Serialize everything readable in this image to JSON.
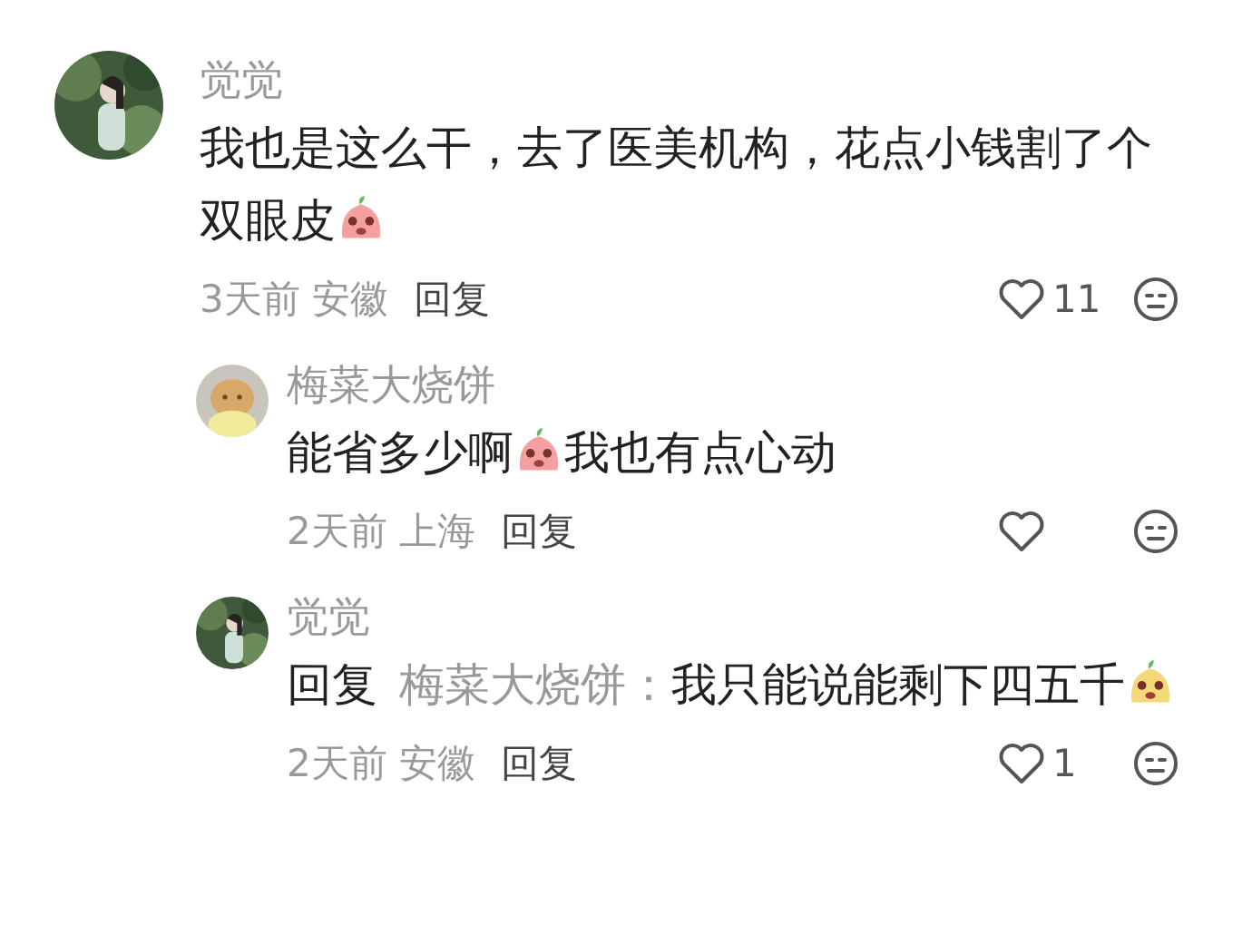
{
  "comments": [
    {
      "author": "觉觉",
      "reply": false,
      "body": [
        {
          "kind": "text",
          "text": "我也是这么干，去了医美机构，花点小钱割了个双眼皮"
        },
        {
          "kind": "emoji",
          "color": "#f4a0a0"
        }
      ],
      "time": "3天前",
      "location": "安徽",
      "reply_label": "回复",
      "likes": "11"
    },
    {
      "author": "梅菜大烧饼",
      "reply": true,
      "body": [
        {
          "kind": "text",
          "text": "能省多少啊"
        },
        {
          "kind": "emoji",
          "color": "#f4a0a0"
        },
        {
          "kind": "text",
          "text": "我也有点心动"
        }
      ],
      "time": "2天前",
      "location": "上海",
      "reply_label": "回复"
    },
    {
      "author": "觉觉",
      "reply": true,
      "body": [
        {
          "kind": "label",
          "text": "回复"
        },
        {
          "kind": "mention",
          "text": "梅菜大烧饼："
        },
        {
          "kind": "text",
          "text": "我只能说能剩下四五千"
        },
        {
          "kind": "emoji",
          "color": "#f5d978"
        }
      ],
      "time": "2天前",
      "location": "安徽",
      "reply_label": "回复",
      "likes": "1"
    }
  ]
}
